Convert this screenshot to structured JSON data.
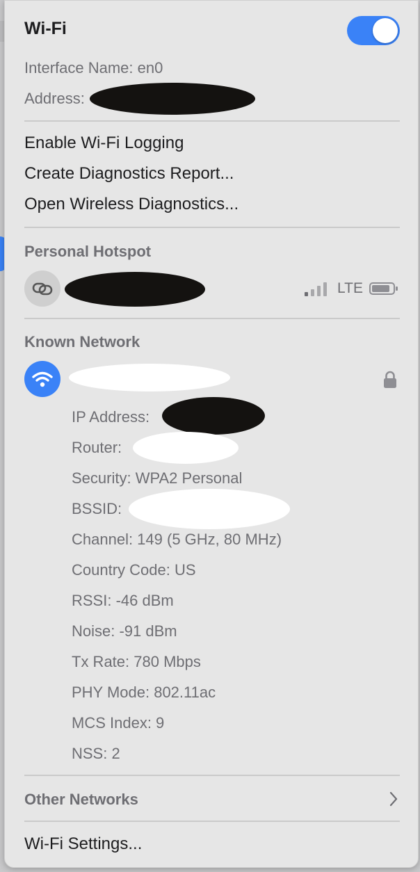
{
  "wifi": {
    "title": "Wi-Fi",
    "enabled": true,
    "interface_name": "Interface Name: en0",
    "address_label": "Address:"
  },
  "actions": [
    "Enable Wi-Fi Logging",
    "Create Diagnostics Report...",
    "Open Wireless Diagnostics..."
  ],
  "hotspot": {
    "heading": "Personal Hotspot",
    "network_type": "LTE"
  },
  "known": {
    "heading": "Known Network",
    "details": [
      "IP Address:",
      "Router:",
      "Security: WPA2 Personal",
      "BSSID:",
      "Channel: 149 (5 GHz, 80 MHz)",
      "Country Code: US",
      "RSSI: -46 dBm",
      "Noise: -91 dBm",
      "Tx Rate: 780 Mbps",
      "PHY Mode: 802.11ac",
      "MCS Index: 9",
      "NSS: 2"
    ]
  },
  "other_networks": "Other Networks",
  "settings": "Wi-Fi Settings...",
  "colors": {
    "accent": "#3a82f7",
    "menu_bg": "#e6e6e6",
    "secondary_text": "#6e6e73"
  },
  "icons": [
    "link-icon",
    "signal-bars-icon",
    "battery-icon",
    "wifi-icon",
    "lock-icon",
    "chevron-right-icon"
  ]
}
